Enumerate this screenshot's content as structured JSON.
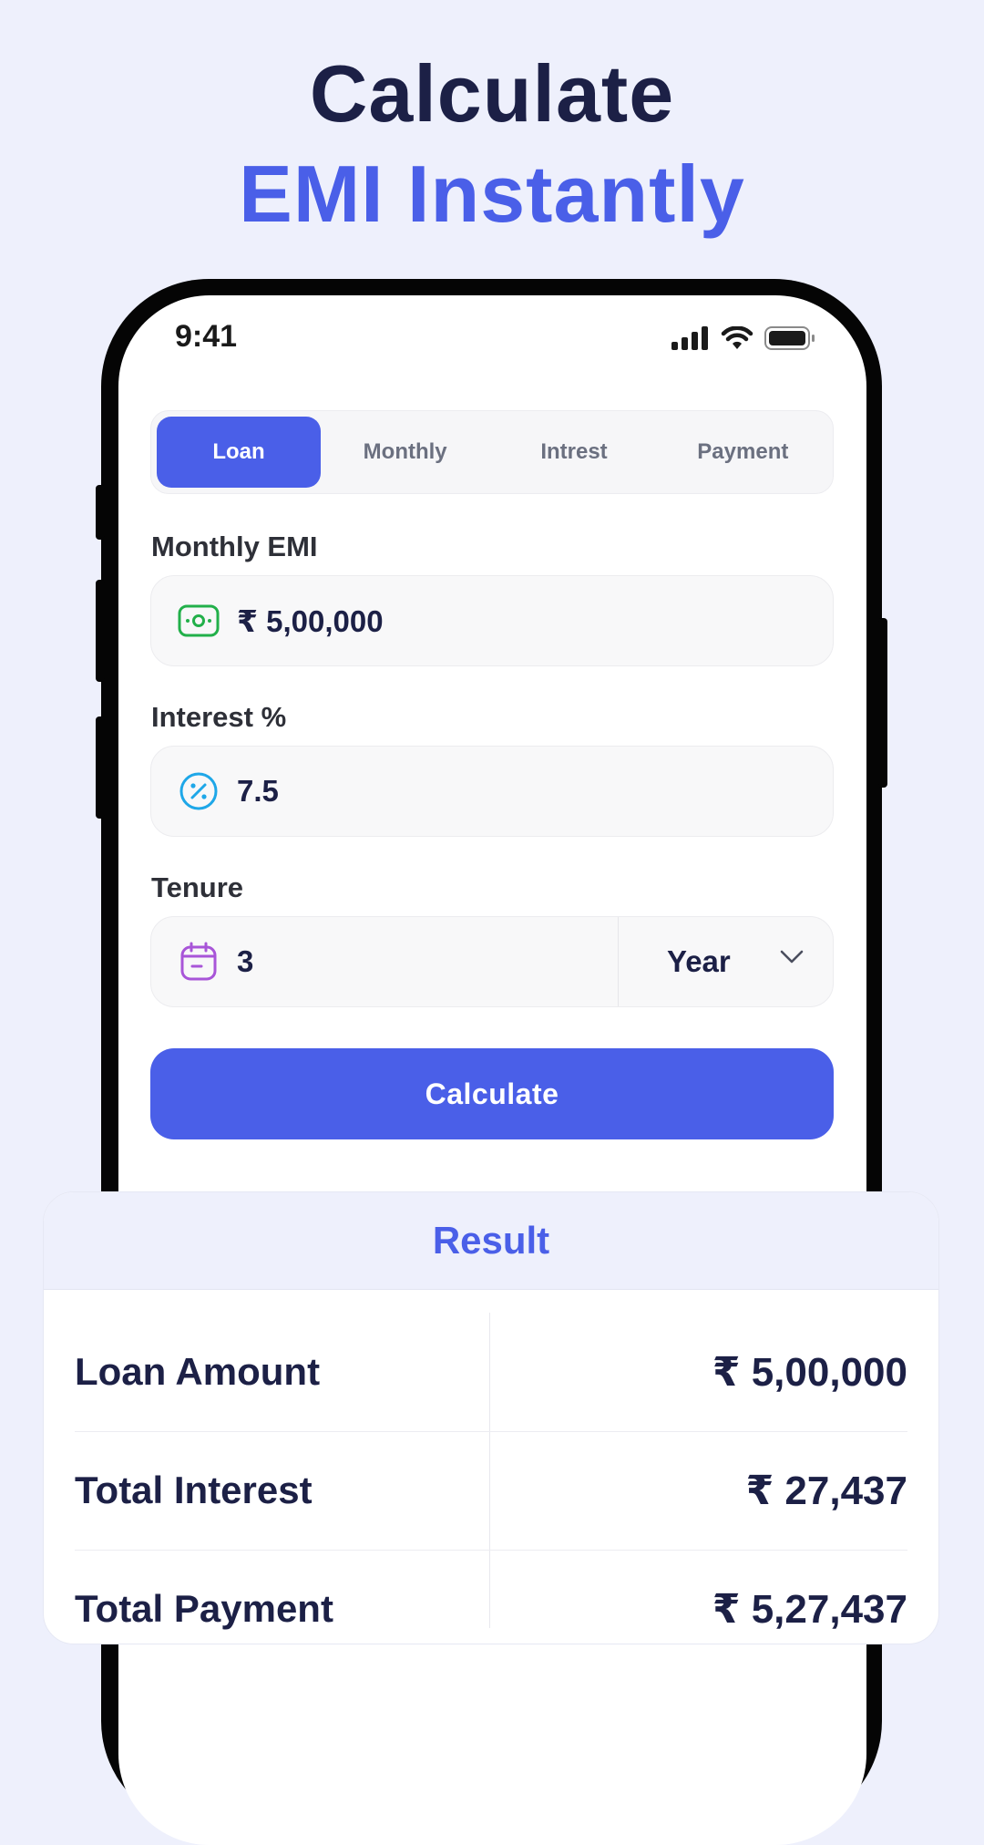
{
  "headline": {
    "line1": "Calculate",
    "line2": "EMI Instantly"
  },
  "status_bar": {
    "time": "9:41"
  },
  "tabs": [
    {
      "label": "Loan",
      "active": true
    },
    {
      "label": "Monthly",
      "active": false
    },
    {
      "label": "Intrest",
      "active": false
    },
    {
      "label": "Payment",
      "active": false
    }
  ],
  "form": {
    "emi_label": "Monthly EMI",
    "emi_value": "₹ 5,00,000",
    "interest_label": "Interest %",
    "interest_value": "7.5",
    "tenure_label": "Tenure",
    "tenure_value": "3",
    "tenure_unit": "Year",
    "calculate_label": "Calculate"
  },
  "result": {
    "title": "Result",
    "rows": [
      {
        "label": "Loan Amount",
        "value": "₹ 5,00,000"
      },
      {
        "label": "Total Interest",
        "value": "₹ 27,437"
      },
      {
        "label": "Total Payment",
        "value": "₹ 5,27,437"
      }
    ]
  },
  "colors": {
    "accent": "#4a5fe8",
    "background": "#eef0fc",
    "text_dark": "#1c2046",
    "money_icon": "#22b04a",
    "percent_icon": "#1ea7e8",
    "calendar_icon": "#a855d8"
  },
  "icons": {
    "emi": "money-icon",
    "interest": "percent-icon",
    "tenure": "calendar-icon",
    "dropdown": "chevron-down-icon"
  }
}
